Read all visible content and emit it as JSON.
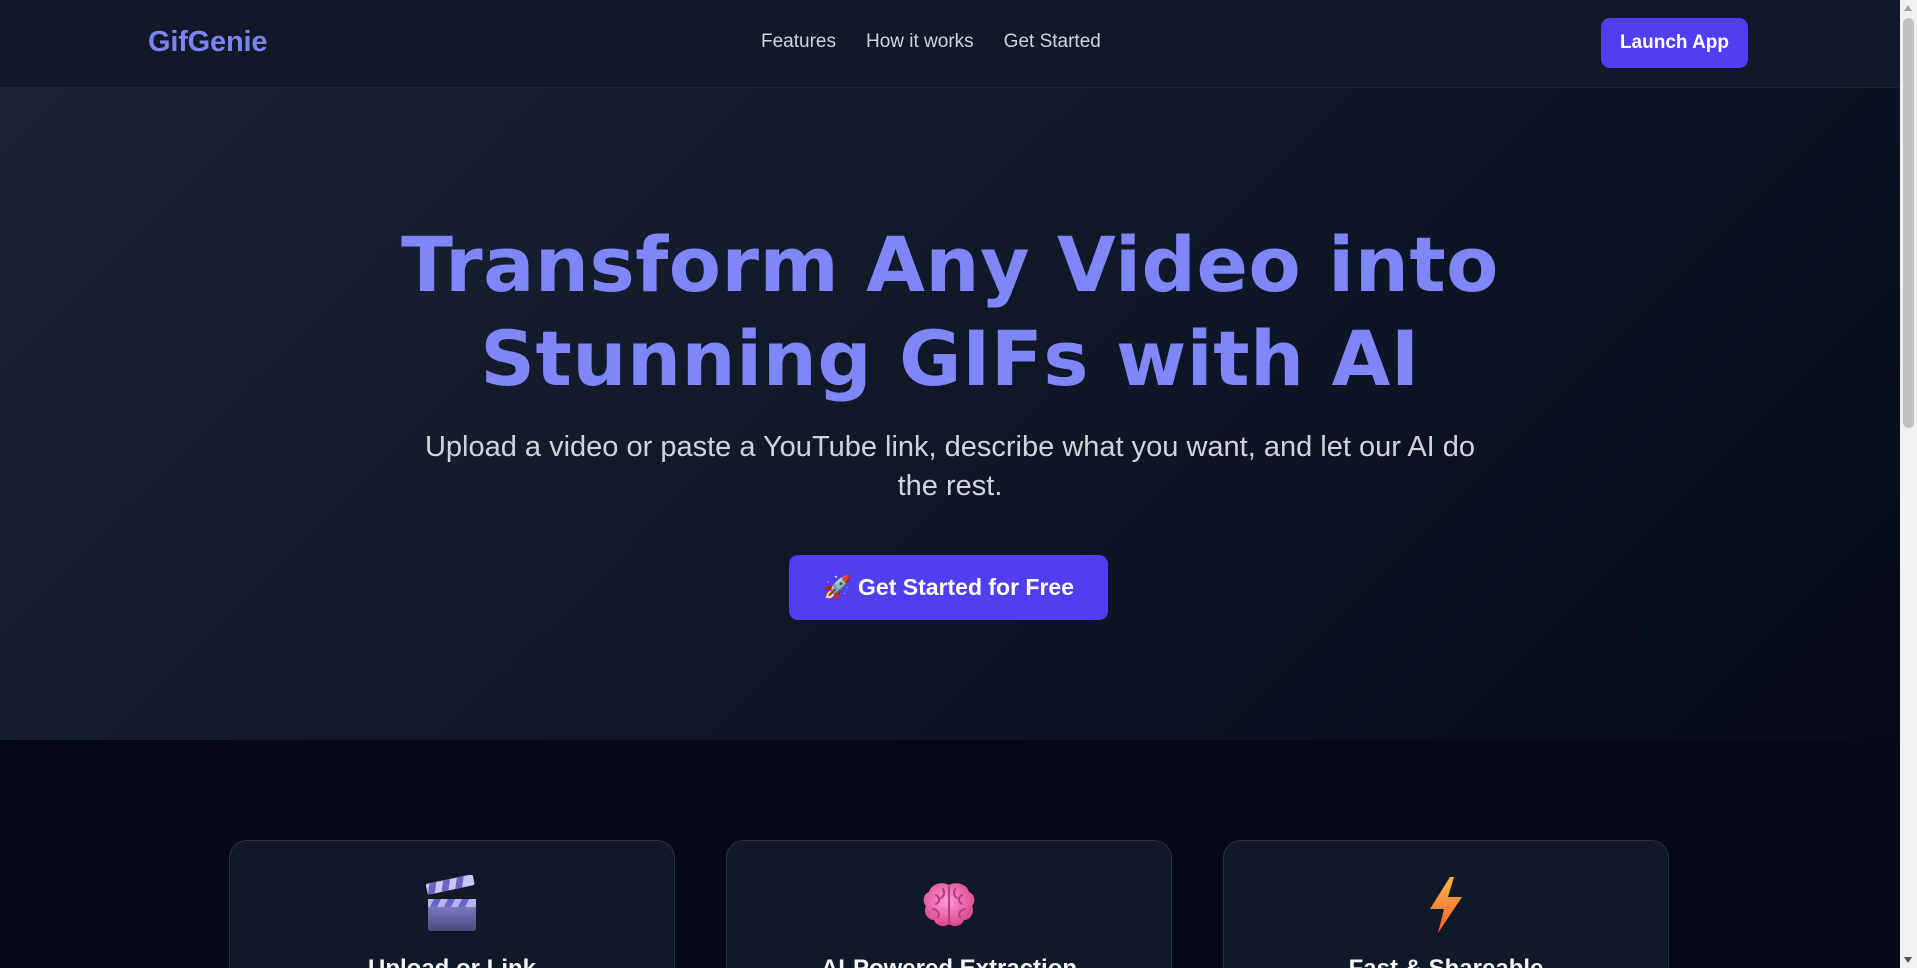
{
  "brand": {
    "name": "GifGenie",
    "color": "#7c83f5"
  },
  "nav": {
    "links": [
      "Features",
      "How it works",
      "Get Started"
    ],
    "launch_label": "Launch App"
  },
  "hero": {
    "title_line1": "Transform Any Video into",
    "title_line2": "Stunning GIFs with AI",
    "subtitle_line1": "Upload a video or paste a YouTube link, describe what you want, and let our AI do",
    "subtitle_line2": "the rest.",
    "cta_icon": "rocket-icon",
    "cta_emoji": "🚀",
    "cta_label": "Get Started for Free"
  },
  "features": [
    {
      "icon": "clapperboard-icon",
      "title": "Upload or Link"
    },
    {
      "icon": "brain-icon",
      "title": "AI-Powered Extraction"
    },
    {
      "icon": "lightning-icon",
      "title": "Fast & Shareable"
    }
  ],
  "colors": {
    "accent": "#4f3ff0",
    "heading": "#7f86f8",
    "background": "#060a16",
    "nav_bg": "#111827"
  }
}
